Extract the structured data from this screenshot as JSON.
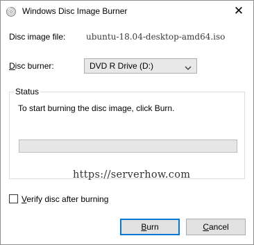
{
  "window": {
    "title": "Windows Disc Image Burner",
    "close_glyph": "✕",
    "app_icon": "disc-burner-icon"
  },
  "image_file": {
    "label": "Disc image file:",
    "value": "ubuntu-18.04-desktop-amd64.iso"
  },
  "burner": {
    "label_mnemonic": "D",
    "label_rest": "isc burner:",
    "selected": "DVD R Drive (D:)"
  },
  "status": {
    "legend": "Status",
    "message": "To start burning the disc image, click Burn.",
    "progress_percent": 0
  },
  "watermark": "https://serverhow.com",
  "verify": {
    "label_mnemonic": "V",
    "label_rest": "erify disc after burning",
    "checked": false
  },
  "buttons": {
    "burn_mnemonic": "B",
    "burn_rest": "urn",
    "cancel_mnemonic": "C",
    "cancel_rest": "ancel"
  },
  "colors": {
    "accent": "#0078d7",
    "progress": "#06b025"
  }
}
